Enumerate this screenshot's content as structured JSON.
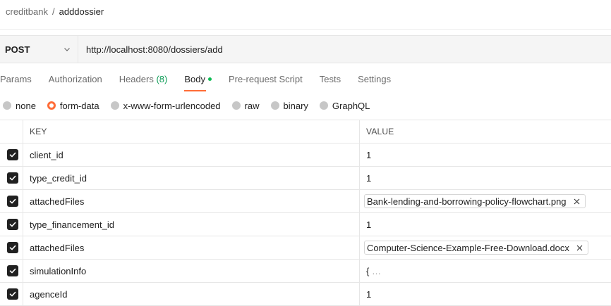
{
  "breadcrumb": {
    "parent": "creditbank",
    "separator": "/",
    "current": "adddossier"
  },
  "request": {
    "method": "POST",
    "url": "http://localhost:8080/dossiers/add"
  },
  "tabs": [
    {
      "label": "Params"
    },
    {
      "label": "Authorization"
    },
    {
      "label": "Headers",
      "count": "(8)"
    },
    {
      "label": "Body",
      "active": true
    },
    {
      "label": "Pre-request Script"
    },
    {
      "label": "Tests"
    },
    {
      "label": "Settings"
    }
  ],
  "body_types": {
    "none": "none",
    "form_data": "form-data",
    "urlencoded": "x-www-form-urlencoded",
    "raw": "raw",
    "binary": "binary",
    "graphql": "GraphQL",
    "selected": "form-data"
  },
  "table": {
    "headers": {
      "key": "KEY",
      "value": "VALUE"
    },
    "rows": [
      {
        "key": "client_id",
        "value": "1",
        "type": "text"
      },
      {
        "key": "type_credit_id",
        "value": "1",
        "type": "text"
      },
      {
        "key": "attachedFiles",
        "value": "Bank-lending-and-borrowing-policy-flowchart.png",
        "type": "file"
      },
      {
        "key": "type_financement_id",
        "value": "1",
        "type": "text"
      },
      {
        "key": "attachedFiles",
        "value": "Computer-Science-Example-Free-Download.docx",
        "type": "file"
      },
      {
        "key": "simulationInfo",
        "value": "{",
        "value_suffix": "…",
        "type": "json"
      },
      {
        "key": "agenceId",
        "value": "1",
        "type": "text"
      }
    ]
  },
  "colors": {
    "accent": "#ff6c37",
    "active_dot": "#0cbb52",
    "count": "#0f9d58"
  },
  "icons": {
    "method_dropdown": "chevron-down-icon",
    "checkbox": "check-icon",
    "remove_file": "close-icon"
  }
}
